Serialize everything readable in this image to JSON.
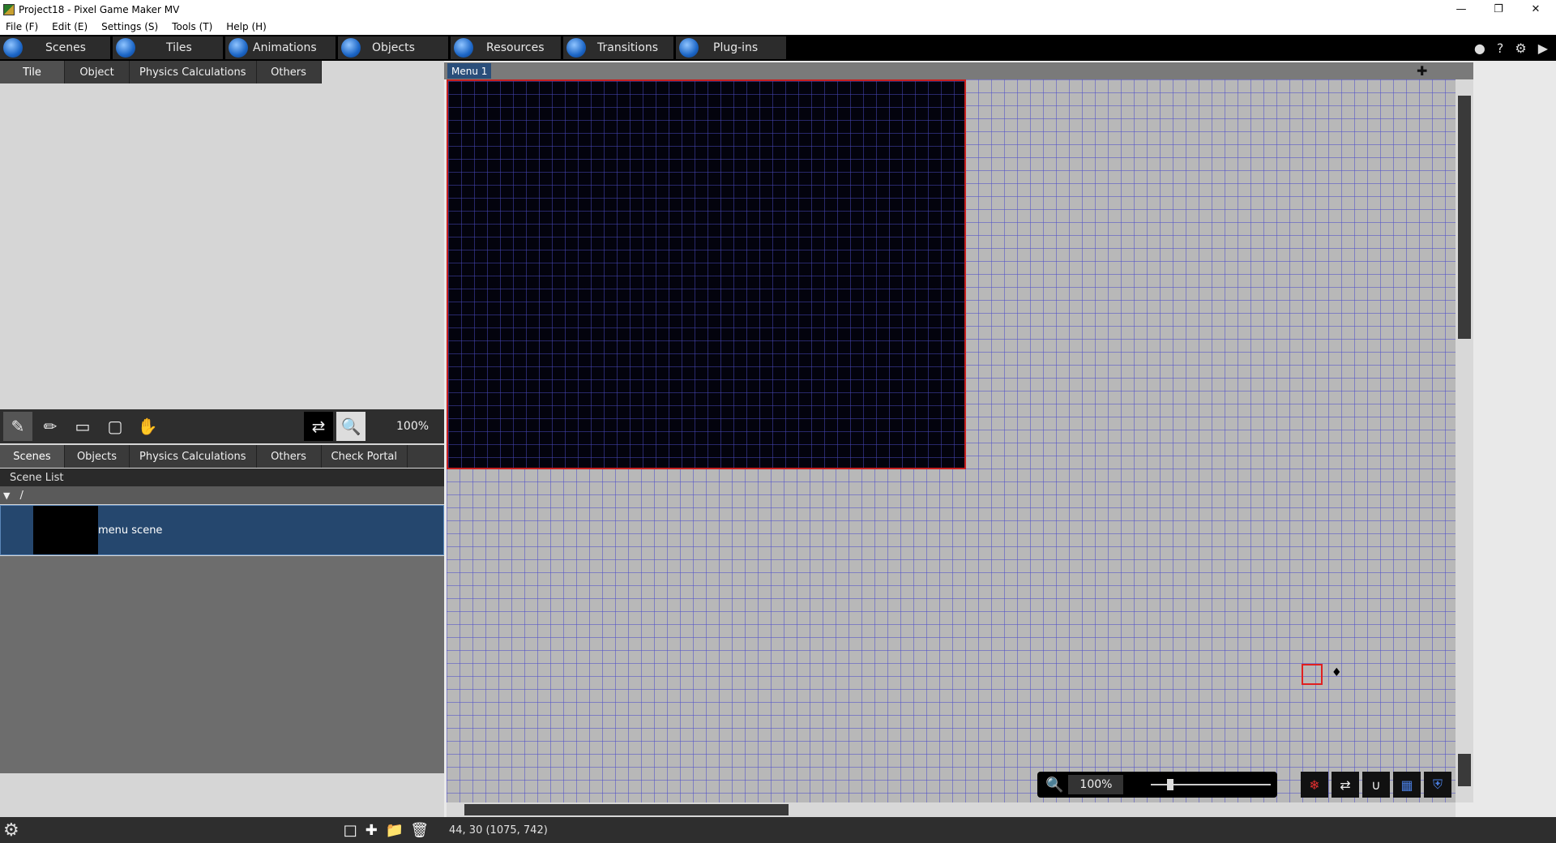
{
  "window": {
    "title": "Project18 - Pixel Game Maker MV"
  },
  "menubar": [
    "File (F)",
    "Edit (E)",
    "Settings (S)",
    "Tools (T)",
    "Help (H)"
  ],
  "maintabs": [
    {
      "label": "Scenes",
      "icon": "scenes-icon"
    },
    {
      "label": "Tiles",
      "icon": "tiles-icon"
    },
    {
      "label": "Animations",
      "icon": "animations-icon"
    },
    {
      "label": "Objects",
      "icon": "objects-icon"
    },
    {
      "label": "Resources",
      "icon": "resources-icon"
    },
    {
      "label": "Transitions",
      "icon": "transitions-icon"
    },
    {
      "label": "Plug-ins",
      "icon": "plugins-icon"
    }
  ],
  "top_subtabs": [
    "Tile",
    "Object",
    "Physics Calculations",
    "Others"
  ],
  "tools": {
    "zoom": "100%"
  },
  "bottom_subtabs": [
    "Scenes",
    "Objects",
    "Physics Calculations",
    "Others",
    "Check Portal"
  ],
  "scene_list": {
    "header": "Scene List",
    "folder": "/",
    "items": [
      {
        "label": "menu scene"
      }
    ]
  },
  "canvas": {
    "tab": "Menu 1",
    "zoom": "100%"
  },
  "status": {
    "coords": "44, 30 (1075, 742)"
  }
}
